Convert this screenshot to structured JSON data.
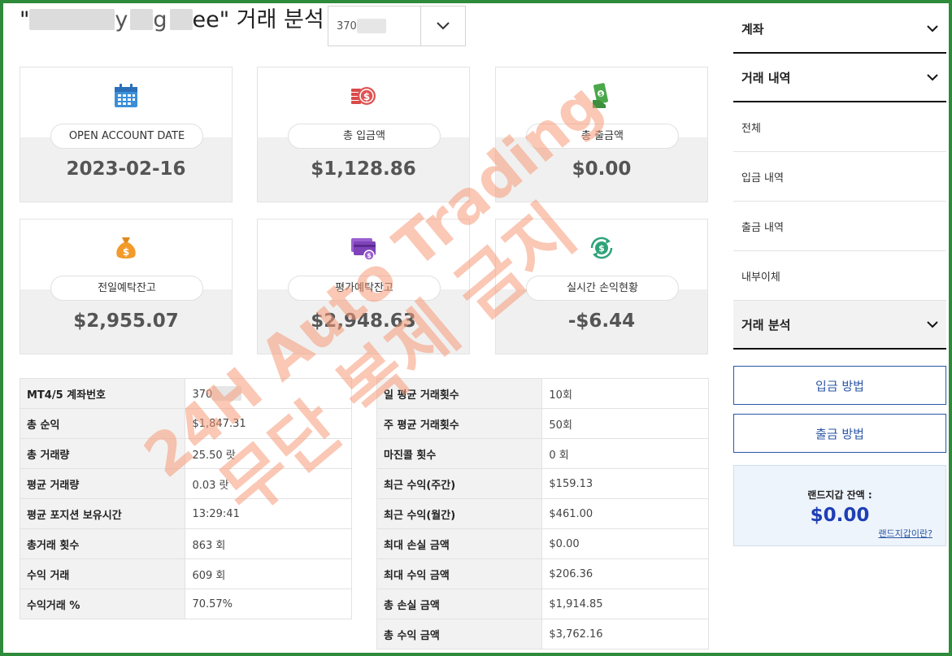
{
  "header": {
    "title_prefix": "\"",
    "title_mid_fragment": "y",
    "title_mid_fragment2": "g",
    "title_suffix": "ee\" 거래 분석",
    "account_select_value": "370"
  },
  "cards": [
    {
      "label": "OPEN ACCOUNT DATE",
      "value": "2023-02-16",
      "icon": "calendar-icon"
    },
    {
      "label": "총 입금액",
      "value": "$1,128.86",
      "icon": "coins-icon"
    },
    {
      "label": "총 출금액",
      "value": "$0.00",
      "icon": "cash-hand-icon"
    },
    {
      "label": "전일예탁잔고",
      "value": "$2,955.07",
      "icon": "money-bag-icon"
    },
    {
      "label": "평가예탁잔고",
      "value": "$2,948.63",
      "icon": "credit-card-icon"
    },
    {
      "label": "실시간 손익현황",
      "value": "-$6.44",
      "icon": "dollar-refresh-icon"
    }
  ],
  "left_table": [
    {
      "key": "MT4/5 계좌번호",
      "value": "370"
    },
    {
      "key": "총 순익",
      "value": "$1,847.31"
    },
    {
      "key": "총 거래량",
      "value": "25.50 랏"
    },
    {
      "key": "평균 거래량",
      "value": "0.03 랏"
    },
    {
      "key": "평균 포지션 보유시간",
      "value": "13:29:41"
    },
    {
      "key": "총거래 횟수",
      "value": "863 회"
    },
    {
      "key": "수익 거래",
      "value": "609 회"
    },
    {
      "key": "수익거래 %",
      "value": "70.57%"
    }
  ],
  "right_table": [
    {
      "key": "일 평균 거래횟수",
      "value": "10회"
    },
    {
      "key": "주 평균 거래횟수",
      "value": "50회"
    },
    {
      "key": "마진콜 횟수",
      "value": "0 회"
    },
    {
      "key": "최근 수익(주간)",
      "value": "$159.13"
    },
    {
      "key": "최근 수익(월간)",
      "value": "$461.00"
    },
    {
      "key": "최대 손실 금액",
      "value": "$0.00"
    },
    {
      "key": "최대 수익 금액",
      "value": "$206.36"
    },
    {
      "key": "총 손실 금액",
      "value": "$1,914.85"
    },
    {
      "key": "총 수익 금액",
      "value": "$3,762.16"
    }
  ],
  "sidebar": {
    "account_label": "계좌",
    "history_label": "거래 내역",
    "history_items": [
      "전체",
      "입금 내역",
      "출금 내역",
      "내부이체"
    ],
    "analysis_label": "거래 분석",
    "deposit_button": "입금 방법",
    "withdraw_button": "출금 방법",
    "wallet_label": "랜드지갑 잔액 :",
    "wallet_amount": "$0.00",
    "wallet_link": "랜드지갑이란?"
  },
  "watermark": {
    "line1": "24H Auto Trading",
    "line2": "무단 복제 금지"
  },
  "colors": {
    "frame": "#2e8b3a",
    "accent_blue": "#2b56a6",
    "wallet_amount": "#1f3fb5",
    "watermark": "#f59a78"
  }
}
